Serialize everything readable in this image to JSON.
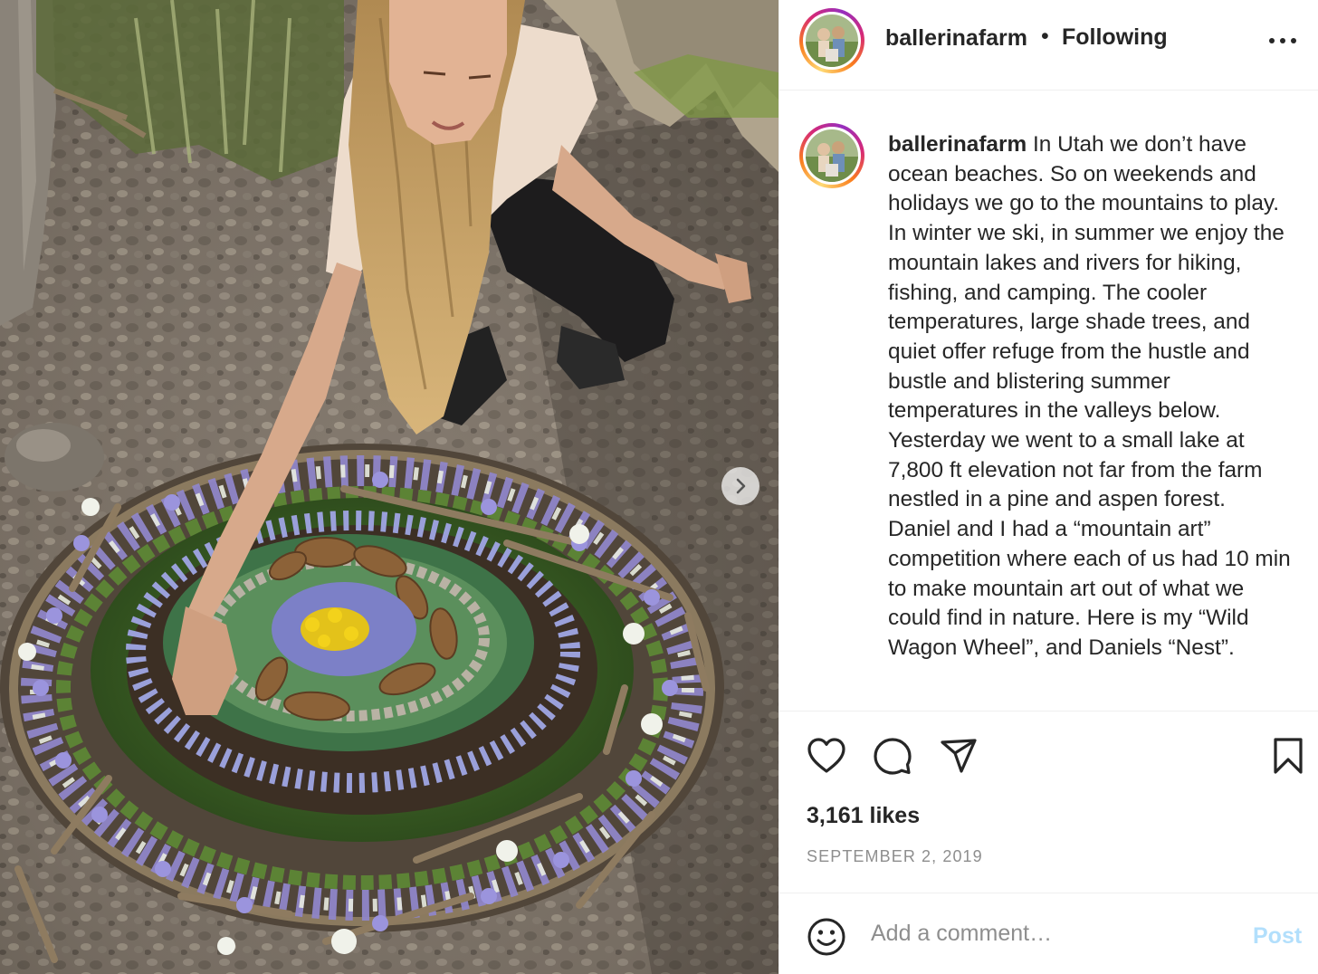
{
  "header": {
    "username": "ballerinafarm",
    "separator": "•",
    "follow_status": "Following",
    "more_icon": "more-horizontal-icon"
  },
  "caption": {
    "username": "ballerinafarm",
    "text": "In Utah we don’t have ocean beaches. So on weekends and holidays we go to the mountains to play. In winter we ski, in summer we enjoy the mountain lakes and rivers for hiking, fishing, and camping. The cooler temperatures, large shade trees, and quiet offer refuge from the hustle and bustle and blistering summer temperatures in the valleys below. Yesterday we went to a small lake at 7,800 ft elevation not far from the farm nestled in a pine and aspen forest. Daniel and I had a “mountain art” competition where each of us had 10 min to make mountain art out of what we could find in nature. Here is my “Wild Wagon Wheel”, and Daniels “Nest”."
  },
  "actions": {
    "like_icon": "heart-icon",
    "comment_icon": "comment-icon",
    "share_icon": "share-icon",
    "save_icon": "bookmark-icon"
  },
  "stats": {
    "likes": "3,161 likes",
    "date": "SEPTEMBER 2, 2019"
  },
  "comment_box": {
    "emoji_icon": "emoji-icon",
    "placeholder": "Add a comment…",
    "post_label": "Post"
  },
  "media": {
    "next_icon": "chevron-right-icon",
    "colors": {
      "post_button_disabled": "#b2dffc",
      "secondary_text": "#8e8e8e",
      "primary_text": "#262626"
    }
  }
}
